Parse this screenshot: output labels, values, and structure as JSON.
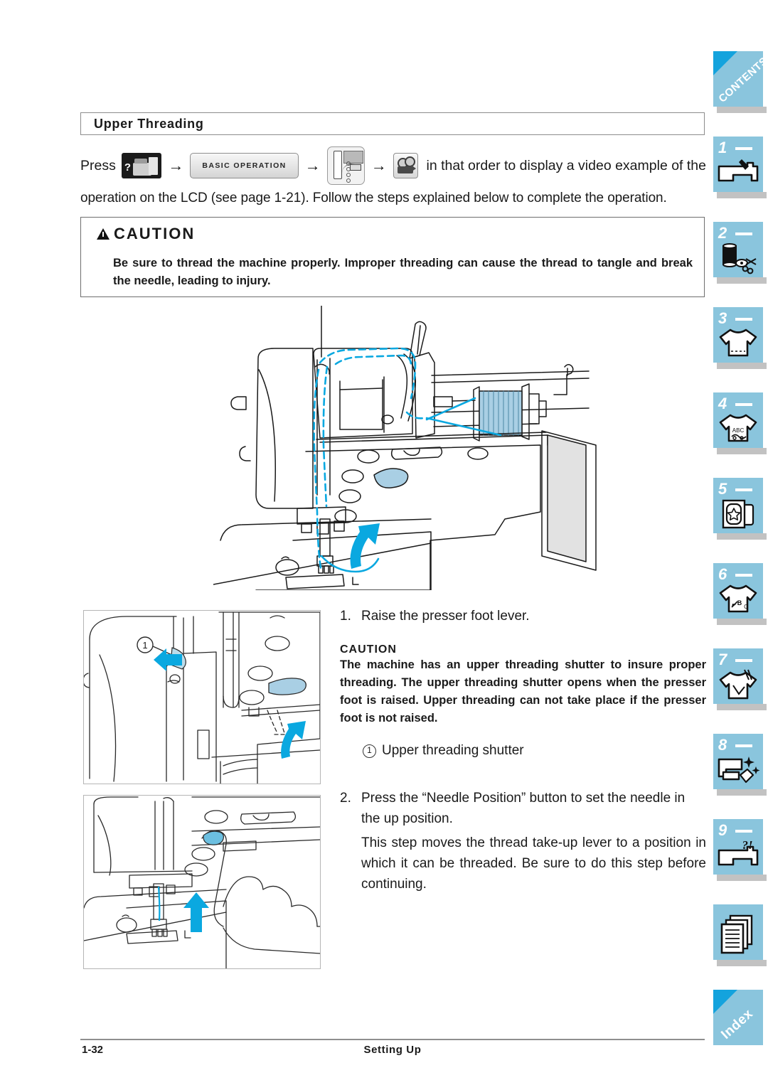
{
  "heading": {
    "title": "Upper Threading"
  },
  "intro": {
    "press_label": "Press",
    "arrow": "→",
    "keys": [
      {
        "name": "home-help-key",
        "label": ""
      },
      {
        "name": "basic-operation-key",
        "label": "BASIC OPERATION"
      },
      {
        "name": "machine-picture-key",
        "label": ""
      },
      {
        "name": "video-camera-key",
        "label": ""
      }
    ],
    "tail_text": "in that order to display a video example of the",
    "second_line": "operation on the LCD (see page 1-21). Follow the steps explained below to complete the operation."
  },
  "caution_main": {
    "title": "CAUTION",
    "body": "Be sure to thread the machine properly. Improper threading can cause the thread to tangle and break the needle, leading to injury."
  },
  "figures": {
    "main": {
      "name": "upper-threading-overview-illustration",
      "caption": ""
    },
    "a": {
      "name": "presser-foot-lever-illustration",
      "callout": "1"
    },
    "b": {
      "name": "needle-position-button-illustration",
      "callout": ""
    }
  },
  "steps": [
    {
      "number": "1.",
      "text": "Raise the presser foot lever."
    },
    {
      "number": "2.",
      "text": "Press the “Needle Position” button to set the needle in the up position.",
      "extra": "This step moves the thread take-up lever to a position in which it can be threaded. Be sure to do this step before continuing."
    }
  ],
  "caution_sub": {
    "title": "CAUTION",
    "body": "The machine has an upper threading shutter to insure proper threading. The upper threading shutter opens when the presser foot is raised. Upper threading can not take place if the presser foot is not raised."
  },
  "callout": {
    "marker": "①",
    "label": "Upper threading shutter"
  },
  "footer": {
    "page_number": "1-32",
    "running_head": "Setting Up"
  },
  "tabs": [
    {
      "kind": "word",
      "label": "CONTENTS",
      "icon": "contents-tab-icon"
    },
    {
      "kind": "num",
      "label": "1",
      "icon": "sewing-machine-icon"
    },
    {
      "kind": "num",
      "label": "2",
      "icon": "thread-spool-scissors-icon"
    },
    {
      "kind": "num",
      "label": "3",
      "icon": "t-shirt-icon"
    },
    {
      "kind": "num",
      "label": "4",
      "icon": "t-shirt-abc-icon"
    },
    {
      "kind": "num",
      "label": "5",
      "icon": "embroidery-frame-star-icon"
    },
    {
      "kind": "num",
      "label": "6",
      "icon": "t-shirt-lettering-icon"
    },
    {
      "kind": "num",
      "label": "7",
      "icon": "t-shirt-needle-icon"
    },
    {
      "kind": "num",
      "label": "8",
      "icon": "machine-cleaning-icon"
    },
    {
      "kind": "num",
      "label": "9",
      "icon": "machine-question-icon"
    },
    {
      "kind": "plain",
      "label": "",
      "icon": "documents-stack-icon"
    },
    {
      "kind": "word",
      "label": "Index",
      "icon": "index-tab-icon"
    }
  ],
  "colors": {
    "tab_blue": "#8ac5dd",
    "tab_corner_blue": "#14a3dd",
    "accent_cyan": "#0aa8e0",
    "thread_fill": "#a9cfe4",
    "shadow_gray": "#bfbfbf"
  }
}
